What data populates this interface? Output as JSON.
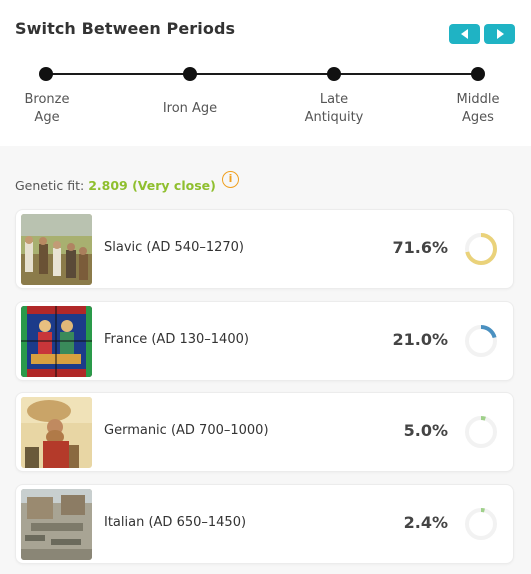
{
  "header": {
    "title": "Switch Between Periods"
  },
  "nav": {
    "prev_icon": "triangle-left-icon",
    "next_icon": "triangle-right-icon",
    "color": "#1fb3c4"
  },
  "timeline": {
    "periods": [
      {
        "label_line1": "Bronze",
        "label_line2": "Age"
      },
      {
        "label_line1": "Iron Age",
        "label_line2": ""
      },
      {
        "label_line1": "Late",
        "label_line2": "Antiquity"
      },
      {
        "label_line1": "Middle",
        "label_line2": "Ages"
      }
    ]
  },
  "fit": {
    "label": "Genetic fit:",
    "value": "2.809 (Very close)",
    "info_icon": "info-icon"
  },
  "results": [
    {
      "name": "Slavic (AD 540–1270)",
      "percent_text": "71.6%",
      "percent": 71.6,
      "ring_color": "#ead27a",
      "thumb": "painting-villagers"
    },
    {
      "name": "France (AD 130–1400)",
      "percent_text": "21.0%",
      "percent": 21.0,
      "ring_color": "#4a90c0",
      "thumb": "stained-glass"
    },
    {
      "name": "Germanic (AD 700–1000)",
      "percent_text": "5.0%",
      "percent": 5.0,
      "ring_color": "#9fd08a",
      "thumb": "painting-warrior"
    },
    {
      "name": "Italian (AD 650–1450)",
      "percent_text": "2.4%",
      "percent": 2.4,
      "ring_color": "#9fd08a",
      "thumb": "photo-ruins"
    }
  ]
}
